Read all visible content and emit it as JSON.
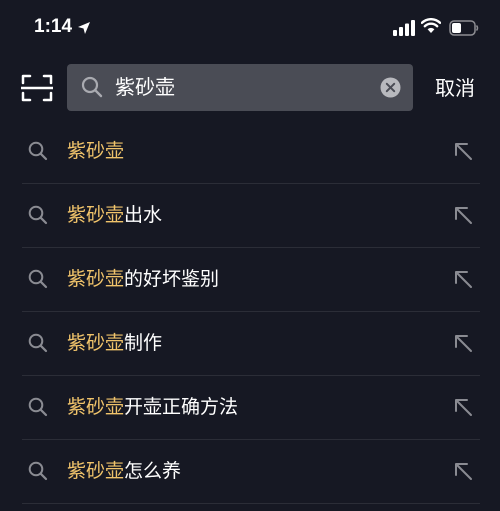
{
  "status_bar": {
    "time": "1:14"
  },
  "search": {
    "query": "紫砂壶",
    "cancel_label": "取消"
  },
  "suggestions": [
    {
      "highlight": "紫砂壶",
      "rest": ""
    },
    {
      "highlight": "紫砂壶",
      "rest": "出水"
    },
    {
      "highlight": "紫砂壶",
      "rest": "的好坏鉴别"
    },
    {
      "highlight": "紫砂壶",
      "rest": "制作"
    },
    {
      "highlight": "紫砂壶",
      "rest": "开壶正确方法"
    },
    {
      "highlight": "紫砂壶",
      "rest": "怎么养"
    }
  ],
  "colors": {
    "background": "#161823",
    "highlight": "#f1c46b",
    "search_box": "#4a4c55"
  }
}
